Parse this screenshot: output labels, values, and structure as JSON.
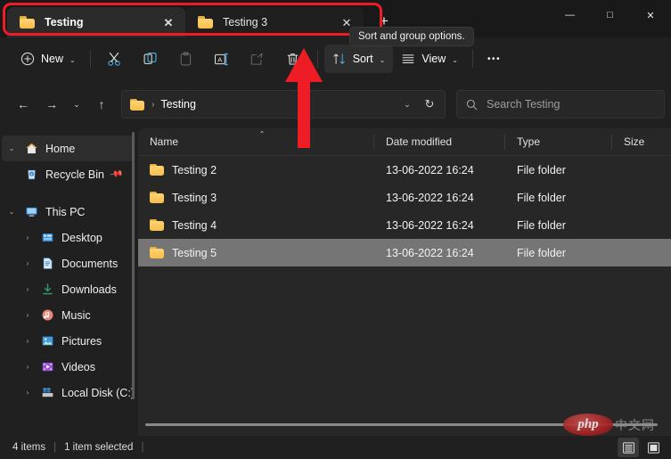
{
  "window": {
    "controls": {
      "minimize": "—",
      "maximize": "□",
      "close": "✕"
    }
  },
  "tabs": {
    "items": [
      {
        "label": "Testing",
        "icon": "folder-icon",
        "close": "✕",
        "active": true
      },
      {
        "label": "Testing 3",
        "icon": "folder-icon",
        "close": "✕",
        "active": false
      }
    ],
    "new_tab_label": "+"
  },
  "toolbar": {
    "new_label": "New",
    "new_icon": "plus-circle-icon",
    "cut_icon": "scissors-icon",
    "copy_icon": "copy-icon",
    "paste_icon": "paste-icon",
    "rename_icon": "rename-icon",
    "share_icon": "share-icon",
    "delete_icon": "trash-icon",
    "sort_label": "Sort",
    "sort_icon": "sort-arrows-icon",
    "view_label": "View",
    "view_icon": "list-lines-icon",
    "more_label": "•••",
    "chevron": "⌄"
  },
  "navigation": {
    "back_icon": "←",
    "forward_icon": "→",
    "recent_icon": "⌄",
    "up_icon": "↑"
  },
  "address": {
    "folder_icon": "folder-icon",
    "separator": "›",
    "crumb": "Testing",
    "dropdown_icon": "⌄",
    "refresh_icon": "↻"
  },
  "search": {
    "icon": "search-icon",
    "placeholder": "Search Testing"
  },
  "sidebar": {
    "items": [
      {
        "label": "Home",
        "icon": "home-icon",
        "expander": "⌄",
        "indent": 0,
        "selected": true,
        "pinned": false
      },
      {
        "label": "Recycle Bin",
        "icon": "recycle-icon",
        "expander": "",
        "indent": 1,
        "selected": false,
        "pinned": true,
        "pin_icon": "📌"
      },
      {
        "label": "This PC",
        "icon": "monitor-icon",
        "expander": "⌄",
        "indent": 0,
        "selected": false,
        "pinned": false,
        "gap_before": true
      },
      {
        "label": "Desktop",
        "icon": "desktop-icon",
        "expander": "›",
        "indent": 1,
        "selected": false,
        "pinned": false
      },
      {
        "label": "Documents",
        "icon": "documents-icon",
        "expander": "›",
        "indent": 1,
        "selected": false,
        "pinned": false
      },
      {
        "label": "Downloads",
        "icon": "download-icon",
        "expander": "›",
        "indent": 1,
        "selected": false,
        "pinned": false
      },
      {
        "label": "Music",
        "icon": "music-icon",
        "expander": "›",
        "indent": 1,
        "selected": false,
        "pinned": false
      },
      {
        "label": "Pictures",
        "icon": "pictures-icon",
        "expander": "›",
        "indent": 1,
        "selected": false,
        "pinned": false
      },
      {
        "label": "Videos",
        "icon": "videos-icon",
        "expander": "›",
        "indent": 1,
        "selected": false,
        "pinned": false
      },
      {
        "label": "Local Disk (C:)",
        "icon": "drive-icon",
        "expander": "›",
        "indent": 1,
        "selected": false,
        "pinned": false
      }
    ]
  },
  "file_list": {
    "columns": [
      {
        "label": "Name",
        "sorted": true,
        "sort_caret": "⌃"
      },
      {
        "label": "Date modified",
        "sorted": false
      },
      {
        "label": "Type",
        "sorted": false
      },
      {
        "label": "Size",
        "sorted": false
      }
    ],
    "rows": [
      {
        "name": "Testing 2",
        "date": "13-06-2022 16:24",
        "type": "File folder",
        "size": "",
        "selected": false
      },
      {
        "name": "Testing 3",
        "date": "13-06-2022 16:24",
        "type": "File folder",
        "size": "",
        "selected": false
      },
      {
        "name": "Testing 4",
        "date": "13-06-2022 16:24",
        "type": "File folder",
        "size": "",
        "selected": false
      },
      {
        "name": "Testing 5",
        "date": "13-06-2022 16:24",
        "type": "File folder",
        "size": "",
        "selected": true
      }
    ]
  },
  "status": {
    "item_count": "4 items",
    "selection": "1 item selected",
    "separator": "|",
    "details_view_icon": "details-view-icon",
    "large_icons_view_icon": "large-icons-view-icon"
  },
  "annotations": {
    "tooltip": "Sort and group options.",
    "highlight_color": "#ee1c25",
    "arrow_color": "#ee1c25"
  },
  "watermark": {
    "logo_text": "php",
    "site_text": "中文网"
  }
}
